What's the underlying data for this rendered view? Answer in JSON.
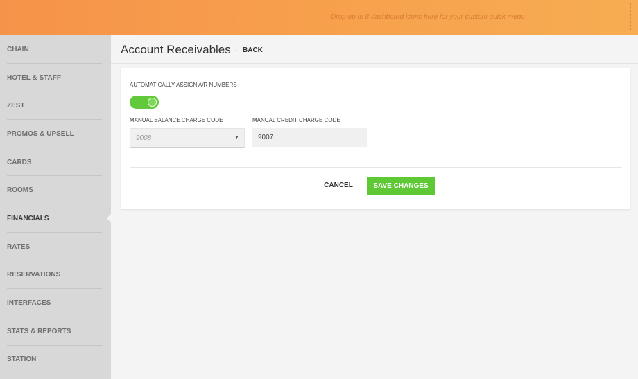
{
  "topbar": {
    "dropzone_text": "Drop up to 8 dashboard icons here for your custom quick menu"
  },
  "sidebar": {
    "items": [
      {
        "label": "CHAIN",
        "active": false
      },
      {
        "label": "HOTEL & STAFF",
        "active": false
      },
      {
        "label": "ZEST",
        "active": false
      },
      {
        "label": "PROMOS & UPSELL",
        "active": false
      },
      {
        "label": "CARDS",
        "active": false
      },
      {
        "label": "ROOMS",
        "active": false
      },
      {
        "label": "FINANCIALS",
        "active": true
      },
      {
        "label": "RATES",
        "active": false
      },
      {
        "label": "RESERVATIONS",
        "active": false
      },
      {
        "label": "INTERFACES",
        "active": false
      },
      {
        "label": "STATS & REPORTS",
        "active": false
      },
      {
        "label": "STATION",
        "active": false
      }
    ]
  },
  "header": {
    "title": "Account Receivables",
    "back_label": "BACK"
  },
  "form": {
    "auto_assign_label": "AUTOMATICALLY ASSIGN A/R NUMBERS",
    "auto_assign_on": true,
    "balance_code_label": "MANUAL BALANCE CHARGE CODE",
    "balance_code_value": "9008",
    "credit_code_label": "MANUAL CREDIT CHARGE CODE",
    "credit_code_value": "9007"
  },
  "actions": {
    "cancel_label": "CANCEL",
    "save_label": "SAVE CHANGES"
  },
  "colors": {
    "topbar_accent": "#f7a04c",
    "primary_green": "#5ec934"
  }
}
